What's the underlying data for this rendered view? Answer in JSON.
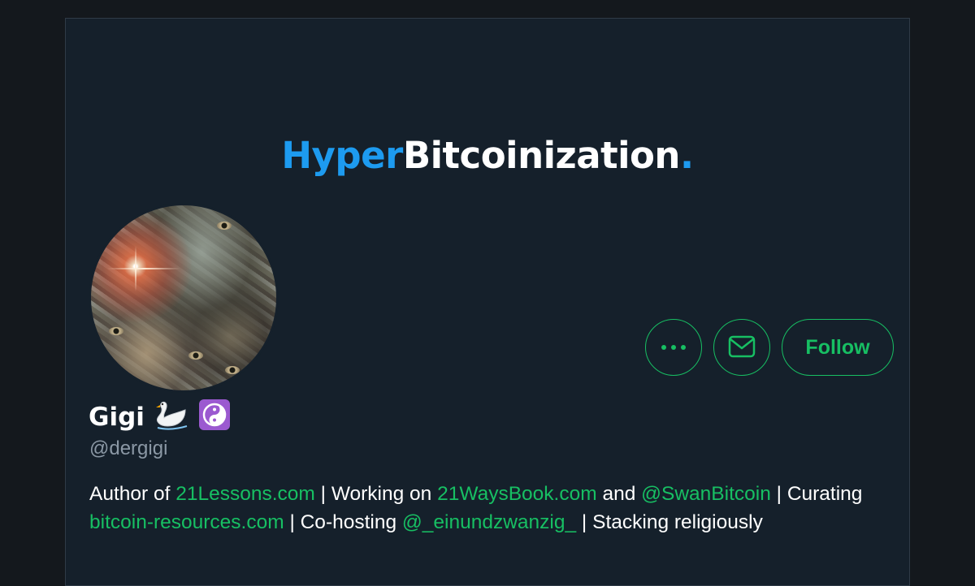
{
  "banner": {
    "title_part1": "Hyper",
    "title_part2": "Bitcoinization",
    "title_part3": "."
  },
  "actions": {
    "more_icon": "more-horizontal-icon",
    "message_icon": "envelope-icon",
    "follow_label": "Follow"
  },
  "profile": {
    "display_name": "Gigi",
    "emoji_icons": [
      "swan-icon",
      "yin-yang-icon"
    ],
    "handle": "@dergigi"
  },
  "bio": {
    "t1": "Author of ",
    "l1": "21Lessons.com",
    "t2": " | Working on ",
    "l2": "21WaysBook.com",
    "t3": " and ",
    "l3": "@SwanBitcoin",
    "t4": " | Curating ",
    "l4": "bitcoin-resources.com",
    "t5": " | Co-hosting ",
    "l5": "@_einundzwanzig_",
    "t6": " | Stacking religiously"
  },
  "colors": {
    "background": "#14181d",
    "card": "#15202b",
    "accent_green": "#17bf63",
    "accent_blue": "#1d9bf0",
    "muted_text": "#8b98a5"
  }
}
